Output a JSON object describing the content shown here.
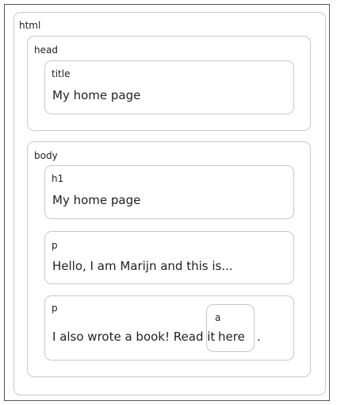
{
  "html": {
    "tag": "html"
  },
  "head": {
    "tag": "head",
    "title": {
      "tag": "title",
      "text": "My home page"
    }
  },
  "body": {
    "tag": "body",
    "h1": {
      "tag": "h1",
      "text": "My home page"
    },
    "p1": {
      "tag": "p",
      "text": "Hello, I am Marijn and this is..."
    },
    "p2": {
      "tag": "p",
      "text": "I also wrote a book! Read it",
      "after": ".",
      "a": {
        "tag": "a",
        "text": "here"
      }
    }
  }
}
